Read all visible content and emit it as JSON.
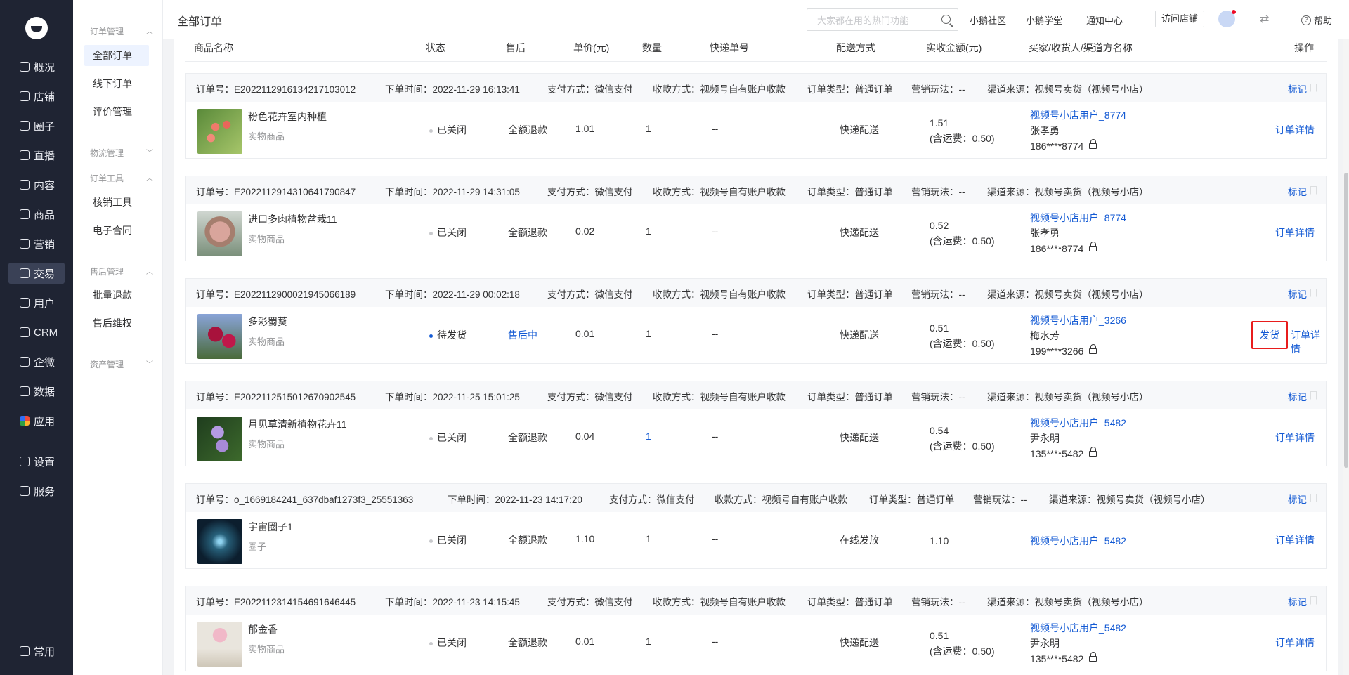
{
  "nav": {
    "items": [
      {
        "label": "概况",
        "icon": "overview-icon"
      },
      {
        "label": "店铺",
        "icon": "store-icon"
      },
      {
        "label": "圈子",
        "icon": "circle-icon"
      },
      {
        "label": "直播",
        "icon": "live-icon"
      },
      {
        "label": "内容",
        "icon": "content-icon"
      },
      {
        "label": "商品",
        "icon": "goods-icon"
      },
      {
        "label": "营销",
        "icon": "marketing-icon"
      },
      {
        "label": "交易",
        "icon": "trade-icon"
      },
      {
        "label": "用户",
        "icon": "user-icon"
      },
      {
        "label": "CRM",
        "icon": "crm-icon"
      },
      {
        "label": "企微",
        "icon": "wecom-icon"
      },
      {
        "label": "数据",
        "icon": "data-icon"
      },
      {
        "label": "应用",
        "icon": "app-icon"
      },
      {
        "label": "设置",
        "icon": "settings-icon"
      },
      {
        "label": "服务",
        "icon": "service-icon"
      }
    ],
    "bottom": {
      "label": "常用"
    }
  },
  "subnav": {
    "groups": [
      {
        "label": "订单管理",
        "items": [
          "全部订单",
          "线下订单",
          "评价管理"
        ]
      },
      {
        "label": "物流管理",
        "items": []
      },
      {
        "label": "订单工具",
        "items": [
          "核销工具",
          "电子合同"
        ]
      },
      {
        "label": "售后管理",
        "items": [
          "批量退款",
          "售后维权"
        ]
      },
      {
        "label": "资产管理",
        "items": []
      }
    ]
  },
  "header": {
    "title": "全部订单",
    "search_placeholder": "大家都在用的热门功能",
    "links": [
      "小鹅社区",
      "小鹅学堂",
      "通知中心"
    ],
    "visit_store": "访问店铺",
    "help": "帮助"
  },
  "table": {
    "columns": [
      "商品名称",
      "状态",
      "售后",
      "单价(元)",
      "数量",
      "快递单号",
      "配送方式",
      "实收金额(元)",
      "买家/收货人/渠道方名称",
      "操作"
    ]
  },
  "orders": [
    {
      "order_no": "订单号：E20221129161342171030​12",
      "order_time": "下单时间：2022-11-29 16:13:41",
      "pay_method": "支付方式：微信支付",
      "receive_method": "收款方式：视频号自有账户收款",
      "order_type": "订单类型：普通订单",
      "marketing": "营销玩法：--",
      "channel": "渠道来源：视频号卖货（视频号小店）",
      "mark": "标记",
      "product": "粉色花卉室内种植",
      "product_type": "实物商品",
      "status": "已关闭",
      "after_sale": "全额退款",
      "price": "1.01",
      "qty": "1",
      "express_no": "--",
      "delivery": "快递配送",
      "amount": "1.51",
      "shipping": "(含运费：0.50)",
      "buyer": "视频号小店用户_8774",
      "receiver": "张孝勇",
      "phone": "186****8774",
      "detail": "订单详情"
    },
    {
      "order_no": "订单号：E20221129143106417908​47",
      "order_time": "下单时间：2022-11-29 14:31:05",
      "pay_method": "支付方式：微信支付",
      "receive_method": "收款方式：视频号自有账户收款",
      "order_type": "订单类型：普通订单",
      "marketing": "营销玩法：--",
      "channel": "渠道来源：视频号卖货（视频号小店）",
      "mark": "标记",
      "product": "进口多肉植物盆栽11",
      "product_type": "实物商品",
      "status": "已关闭",
      "after_sale": "全额退款",
      "price": "0.02",
      "qty": "1",
      "express_no": "--",
      "delivery": "快递配送",
      "amount": "0.52",
      "shipping": "(含运费：0.50)",
      "buyer": "视频号小店用户_8774",
      "receiver": "张孝勇",
      "phone": "186****8774",
      "detail": "订单详情"
    },
    {
      "order_no": "订单号：E20221129000219450661​89",
      "order_time": "下单时间：2022-11-29 00:02:18",
      "pay_method": "支付方式：微信支付",
      "receive_method": "收款方式：视频号自有账户收款",
      "order_type": "订单类型：普通订单",
      "marketing": "营销玩法：--",
      "channel": "渠道来源：视频号卖货（视频号小店）",
      "mark": "标记",
      "product": "多彩蜀葵",
      "product_type": "实物商品",
      "status": "待发货",
      "after_sale": "售后中",
      "price": "0.01",
      "qty": "1",
      "express_no": "--",
      "delivery": "快递配送",
      "amount": "0.51",
      "shipping": "(含运费：0.50)",
      "buyer": "视频号小店用户_3266",
      "receiver": "梅水芳",
      "phone": "199****3266",
      "ship": "发货",
      "detail": "订单详情"
    },
    {
      "order_no": "订单号：E20221125150126709025​45",
      "order_time": "下单时间：2022-11-25 15:01:25",
      "pay_method": "支付方式：微信支付",
      "receive_method": "收款方式：视频号自有账户收款",
      "order_type": "订单类型：普通订单",
      "marketing": "营销玩法：--",
      "channel": "渠道来源：视频号卖货（视频号小店）",
      "mark": "标记",
      "product": "月见草清新植物花卉11",
      "product_type": "实物商品",
      "status": "已关闭",
      "after_sale": "全额退款",
      "price": "0.04",
      "qty": "1",
      "express_no": "--",
      "delivery": "快递配送",
      "amount": "0.54",
      "shipping": "(含运费：0.50)",
      "buyer": "视频号小店用户_5482",
      "receiver": "尹永明",
      "phone": "135****5482",
      "detail": "订单详情"
    },
    {
      "order_no": "订单号：o_1669184241_637dbaf1273f3_25551363",
      "order_time": "下单时间：2022-11-23 14:17:20",
      "pay_method": "支付方式：微信支付",
      "receive_method": "收款方式：视频号自有账户收款",
      "order_type": "订单类型：普通订单",
      "marketing": "营销玩法：--",
      "channel": "渠道来源：视频号卖货（视频号小店）",
      "mark": "标记",
      "product": "宇宙圈子1",
      "product_type": "圈子",
      "status": "已关闭",
      "after_sale": "全额退款",
      "price": "1.10",
      "qty": "1",
      "express_no": "--",
      "delivery": "在线发放",
      "amount": "1.10",
      "buyer": "视频号小店用户_5482",
      "detail": "订单详情"
    },
    {
      "order_no": "订单号：E20221123141546916464​45",
      "order_time": "下单时间：2022-11-23 14:15:45",
      "pay_method": "支付方式：微信支付",
      "receive_method": "收款方式：视频号自有账户收款",
      "order_type": "订单类型：普通订单",
      "marketing": "营销玩法：--",
      "channel": "渠道来源：视频号卖货（视频号小店）",
      "mark": "标记",
      "product": "郁金香",
      "product_type": "实物商品",
      "status": "已关闭",
      "after_sale": "全额退款",
      "price": "0.01",
      "qty": "1",
      "express_no": "--",
      "delivery": "快递配送",
      "amount": "0.51",
      "shipping": "(含运费：0.50)",
      "buyer": "视频号小店用户_5482",
      "receiver": "尹永明",
      "phone": "135****5482",
      "detail": "订单详情"
    }
  ]
}
